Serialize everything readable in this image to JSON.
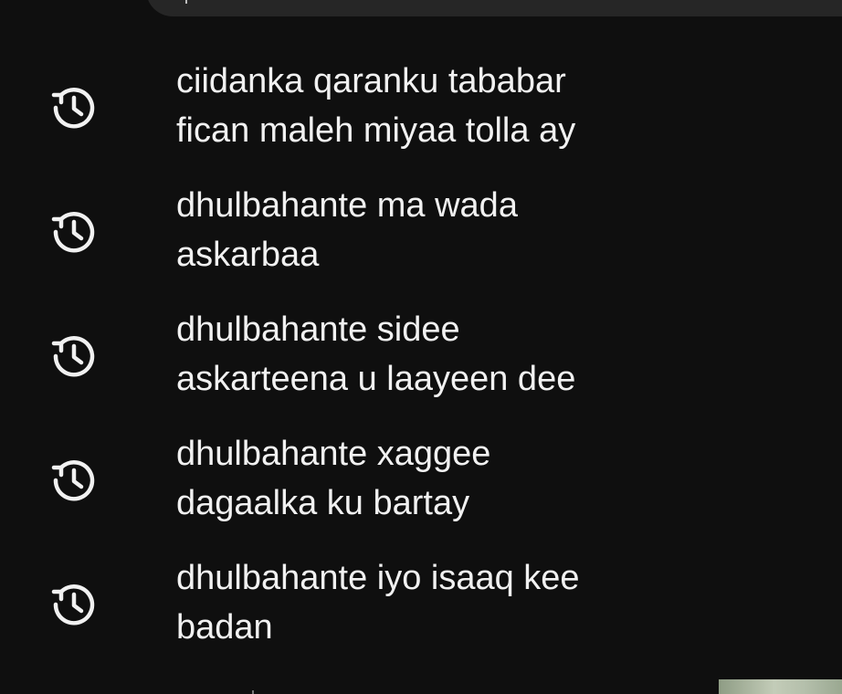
{
  "history": {
    "items": [
      {
        "line1": "ciidanka qaranku tababar",
        "line2": "fican maleh miyaa tolla ay",
        "icon": "history-icon"
      },
      {
        "line1": "dhulbahante ma wada",
        "line2": "askarbaa",
        "icon": "history-icon"
      },
      {
        "line1": "dhulbahante sidee",
        "line2": "askarteena u laayeen dee",
        "icon": "history-icon"
      },
      {
        "line1": "dhulbahante xaggee",
        "line2": "dagaalka ku bartay",
        "icon": "history-icon"
      },
      {
        "line1": "dhulbahante iyo isaaq kee",
        "line2": "badan",
        "icon": "history-icon"
      }
    ]
  },
  "colors": {
    "background": "#0f0f0f",
    "text": "#f1f1f1",
    "icon": "#f1f1f1",
    "search_bar": "#262626"
  }
}
